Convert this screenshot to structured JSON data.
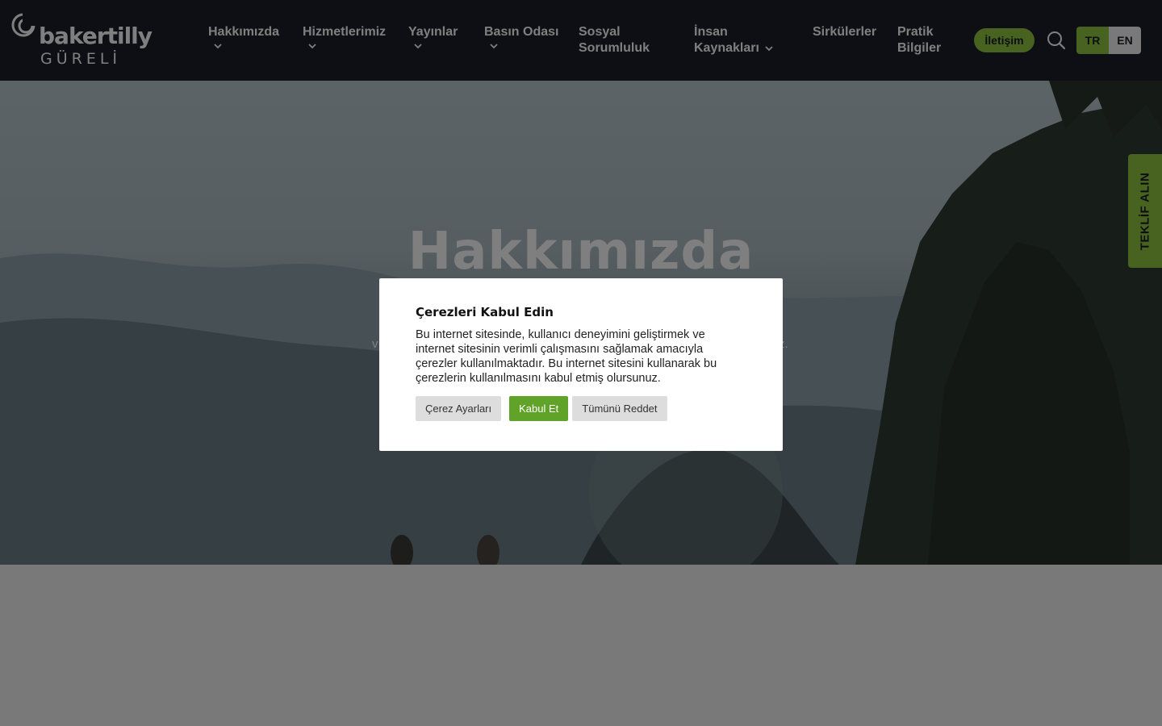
{
  "header": {
    "logo": {
      "word": "bakertilly",
      "sub": "GÜRELİ"
    },
    "nav": [
      {
        "label": "Hakkımızda",
        "dropdown": true
      },
      {
        "label": "Hizmetlerimiz",
        "dropdown": true
      },
      {
        "label": "Yayınlar",
        "dropdown": true
      },
      {
        "label": "Basın Odası",
        "dropdown": true
      },
      {
        "label_line1": "Sosyal",
        "label_line2": "Sorumluluk",
        "dropdown": false
      },
      {
        "label_line1": "İnsan",
        "label_line2": "Kaynakları",
        "dropdown": true
      },
      {
        "label": "Sirkülerler",
        "dropdown": false
      },
      {
        "label_line1": "Pratik",
        "label_line2": "Bilgiler",
        "dropdown": false
      }
    ],
    "contact_label": "İletişim",
    "search_icon": "search-icon",
    "languages": {
      "tr": "TR",
      "en": "EN",
      "active": "TR"
    }
  },
  "hero": {
    "title": "Hakkımızda",
    "subtitle_fragment_left": "v",
    "subtitle_fragment_right": "z."
  },
  "side_tab": {
    "label": "TEKLİF ALIN"
  },
  "cookie_modal": {
    "title": "Çerezleri Kabul Edin",
    "text": "Bu internet sitesinde, kullanıcı deneyimini geliştirmek ve internet sitesinin verimli çalışmasını sağlamak amacıyla çerezler kullanılmaktadır. Bu internet sitesini kullanarak bu çerezlerin kullanılmasını kabul etmiş olursunuz.",
    "buttons": {
      "settings": "Çerez Ayarları",
      "accept": "Kabul Et",
      "reject": "Tümünü Reddet"
    }
  },
  "colors": {
    "brand_green": "#8ec63f",
    "accept_green": "#61a229",
    "header_bg": "#1a1f28"
  }
}
